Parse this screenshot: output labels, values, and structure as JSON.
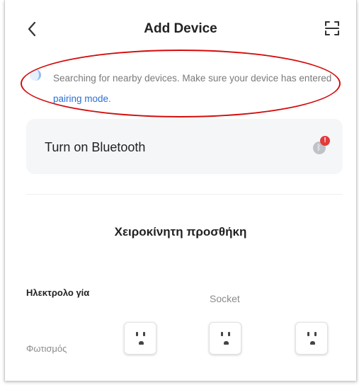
{
  "header": {
    "title": "Add Device"
  },
  "search": {
    "text": "Searching for nearby devices. Make sure your device has entered",
    "link": "pairing mode",
    "suffix": "."
  },
  "bluetooth": {
    "label": "Turn on Bluetooth",
    "badge": "!"
  },
  "manual": {
    "title": "Χειροκίνητη προσθήκη"
  },
  "categories": [
    {
      "label": "Ηλεκτρολο γία",
      "active": true
    },
    {
      "label": "Φωτισμός",
      "active": false
    }
  ],
  "group": {
    "label": "Socket"
  },
  "products": [
    {
      "icon": "socket-icon"
    },
    {
      "icon": "socket-icon"
    },
    {
      "icon": "socket-icon"
    }
  ],
  "colors": {
    "accent": "#2a6fd6",
    "highlight": "#d40c0c",
    "badge": "#e23b3b",
    "card": "#f5f6f8"
  }
}
